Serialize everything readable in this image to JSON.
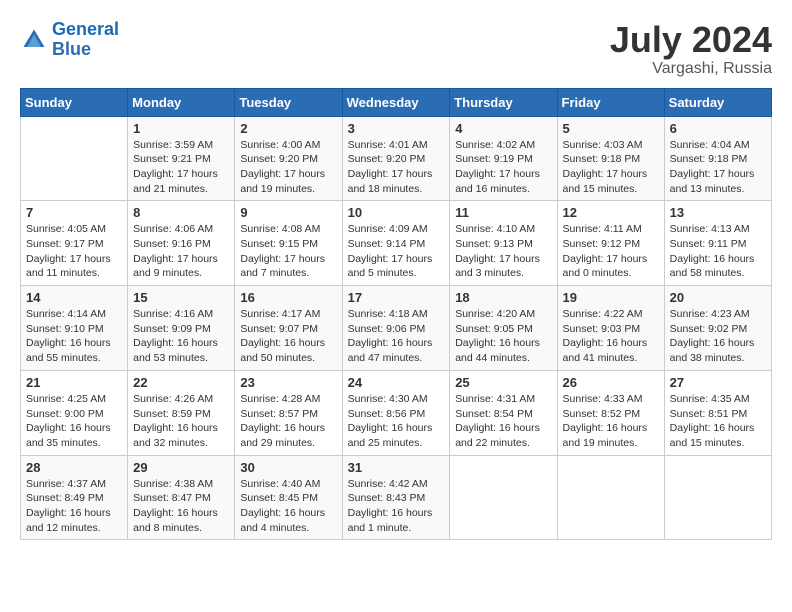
{
  "logo": {
    "line1": "General",
    "line2": "Blue"
  },
  "title": "July 2024",
  "location": "Vargashi, Russia",
  "days_header": [
    "Sunday",
    "Monday",
    "Tuesday",
    "Wednesday",
    "Thursday",
    "Friday",
    "Saturday"
  ],
  "weeks": [
    [
      {
        "day": "",
        "sunrise": "",
        "sunset": "",
        "daylight": ""
      },
      {
        "day": "1",
        "sunrise": "Sunrise: 3:59 AM",
        "sunset": "Sunset: 9:21 PM",
        "daylight": "Daylight: 17 hours and 21 minutes."
      },
      {
        "day": "2",
        "sunrise": "Sunrise: 4:00 AM",
        "sunset": "Sunset: 9:20 PM",
        "daylight": "Daylight: 17 hours and 19 minutes."
      },
      {
        "day": "3",
        "sunrise": "Sunrise: 4:01 AM",
        "sunset": "Sunset: 9:20 PM",
        "daylight": "Daylight: 17 hours and 18 minutes."
      },
      {
        "day": "4",
        "sunrise": "Sunrise: 4:02 AM",
        "sunset": "Sunset: 9:19 PM",
        "daylight": "Daylight: 17 hours and 16 minutes."
      },
      {
        "day": "5",
        "sunrise": "Sunrise: 4:03 AM",
        "sunset": "Sunset: 9:18 PM",
        "daylight": "Daylight: 17 hours and 15 minutes."
      },
      {
        "day": "6",
        "sunrise": "Sunrise: 4:04 AM",
        "sunset": "Sunset: 9:18 PM",
        "daylight": "Daylight: 17 hours and 13 minutes."
      }
    ],
    [
      {
        "day": "7",
        "sunrise": "Sunrise: 4:05 AM",
        "sunset": "Sunset: 9:17 PM",
        "daylight": "Daylight: 17 hours and 11 minutes."
      },
      {
        "day": "8",
        "sunrise": "Sunrise: 4:06 AM",
        "sunset": "Sunset: 9:16 PM",
        "daylight": "Daylight: 17 hours and 9 minutes."
      },
      {
        "day": "9",
        "sunrise": "Sunrise: 4:08 AM",
        "sunset": "Sunset: 9:15 PM",
        "daylight": "Daylight: 17 hours and 7 minutes."
      },
      {
        "day": "10",
        "sunrise": "Sunrise: 4:09 AM",
        "sunset": "Sunset: 9:14 PM",
        "daylight": "Daylight: 17 hours and 5 minutes."
      },
      {
        "day": "11",
        "sunrise": "Sunrise: 4:10 AM",
        "sunset": "Sunset: 9:13 PM",
        "daylight": "Daylight: 17 hours and 3 minutes."
      },
      {
        "day": "12",
        "sunrise": "Sunrise: 4:11 AM",
        "sunset": "Sunset: 9:12 PM",
        "daylight": "Daylight: 17 hours and 0 minutes."
      },
      {
        "day": "13",
        "sunrise": "Sunrise: 4:13 AM",
        "sunset": "Sunset: 9:11 PM",
        "daylight": "Daylight: 16 hours and 58 minutes."
      }
    ],
    [
      {
        "day": "14",
        "sunrise": "Sunrise: 4:14 AM",
        "sunset": "Sunset: 9:10 PM",
        "daylight": "Daylight: 16 hours and 55 minutes."
      },
      {
        "day": "15",
        "sunrise": "Sunrise: 4:16 AM",
        "sunset": "Sunset: 9:09 PM",
        "daylight": "Daylight: 16 hours and 53 minutes."
      },
      {
        "day": "16",
        "sunrise": "Sunrise: 4:17 AM",
        "sunset": "Sunset: 9:07 PM",
        "daylight": "Daylight: 16 hours and 50 minutes."
      },
      {
        "day": "17",
        "sunrise": "Sunrise: 4:18 AM",
        "sunset": "Sunset: 9:06 PM",
        "daylight": "Daylight: 16 hours and 47 minutes."
      },
      {
        "day": "18",
        "sunrise": "Sunrise: 4:20 AM",
        "sunset": "Sunset: 9:05 PM",
        "daylight": "Daylight: 16 hours and 44 minutes."
      },
      {
        "day": "19",
        "sunrise": "Sunrise: 4:22 AM",
        "sunset": "Sunset: 9:03 PM",
        "daylight": "Daylight: 16 hours and 41 minutes."
      },
      {
        "day": "20",
        "sunrise": "Sunrise: 4:23 AM",
        "sunset": "Sunset: 9:02 PM",
        "daylight": "Daylight: 16 hours and 38 minutes."
      }
    ],
    [
      {
        "day": "21",
        "sunrise": "Sunrise: 4:25 AM",
        "sunset": "Sunset: 9:00 PM",
        "daylight": "Daylight: 16 hours and 35 minutes."
      },
      {
        "day": "22",
        "sunrise": "Sunrise: 4:26 AM",
        "sunset": "Sunset: 8:59 PM",
        "daylight": "Daylight: 16 hours and 32 minutes."
      },
      {
        "day": "23",
        "sunrise": "Sunrise: 4:28 AM",
        "sunset": "Sunset: 8:57 PM",
        "daylight": "Daylight: 16 hours and 29 minutes."
      },
      {
        "day": "24",
        "sunrise": "Sunrise: 4:30 AM",
        "sunset": "Sunset: 8:56 PM",
        "daylight": "Daylight: 16 hours and 25 minutes."
      },
      {
        "day": "25",
        "sunrise": "Sunrise: 4:31 AM",
        "sunset": "Sunset: 8:54 PM",
        "daylight": "Daylight: 16 hours and 22 minutes."
      },
      {
        "day": "26",
        "sunrise": "Sunrise: 4:33 AM",
        "sunset": "Sunset: 8:52 PM",
        "daylight": "Daylight: 16 hours and 19 minutes."
      },
      {
        "day": "27",
        "sunrise": "Sunrise: 4:35 AM",
        "sunset": "Sunset: 8:51 PM",
        "daylight": "Daylight: 16 hours and 15 minutes."
      }
    ],
    [
      {
        "day": "28",
        "sunrise": "Sunrise: 4:37 AM",
        "sunset": "Sunset: 8:49 PM",
        "daylight": "Daylight: 16 hours and 12 minutes."
      },
      {
        "day": "29",
        "sunrise": "Sunrise: 4:38 AM",
        "sunset": "Sunset: 8:47 PM",
        "daylight": "Daylight: 16 hours and 8 minutes."
      },
      {
        "day": "30",
        "sunrise": "Sunrise: 4:40 AM",
        "sunset": "Sunset: 8:45 PM",
        "daylight": "Daylight: 16 hours and 4 minutes."
      },
      {
        "day": "31",
        "sunrise": "Sunrise: 4:42 AM",
        "sunset": "Sunset: 8:43 PM",
        "daylight": "Daylight: 16 hours and 1 minute."
      },
      {
        "day": "",
        "sunrise": "",
        "sunset": "",
        "daylight": ""
      },
      {
        "day": "",
        "sunrise": "",
        "sunset": "",
        "daylight": ""
      },
      {
        "day": "",
        "sunrise": "",
        "sunset": "",
        "daylight": ""
      }
    ]
  ]
}
